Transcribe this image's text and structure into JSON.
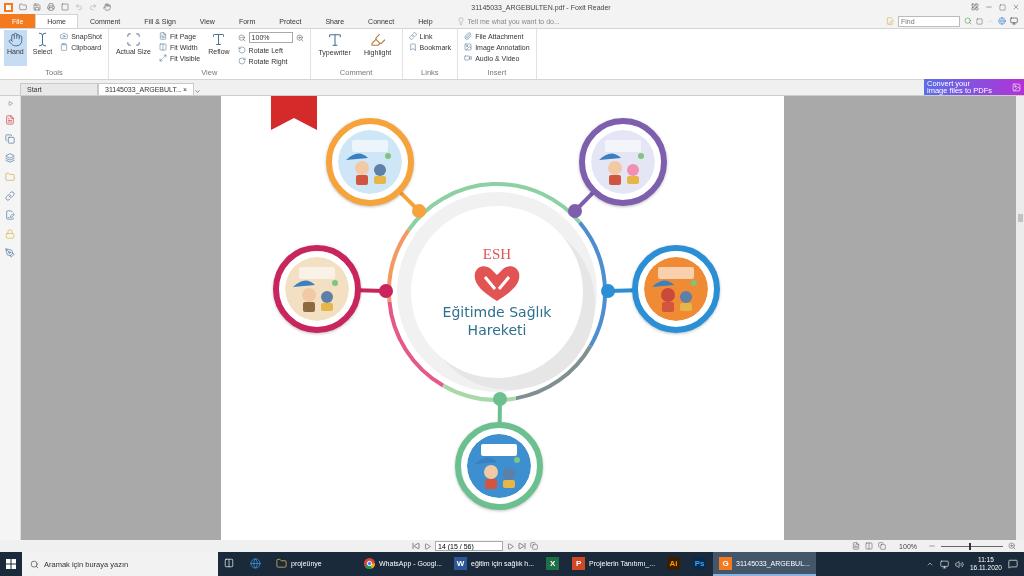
{
  "window": {
    "title": "31145033_ARGEBULTEN.pdf - Foxit Reader"
  },
  "menu_tabs": [
    {
      "label": "File",
      "kind": "file",
      "selected": false
    },
    {
      "label": "Home",
      "kind": "tab",
      "selected": true
    },
    {
      "label": "Comment",
      "kind": "tab",
      "selected": false
    },
    {
      "label": "Fill & Sign",
      "kind": "tab",
      "selected": false
    },
    {
      "label": "View",
      "kind": "tab",
      "selected": false
    },
    {
      "label": "Form",
      "kind": "tab",
      "selected": false
    },
    {
      "label": "Protect",
      "kind": "tab",
      "selected": false
    },
    {
      "label": "Share",
      "kind": "tab",
      "selected": false
    },
    {
      "label": "Connect",
      "kind": "tab",
      "selected": false
    },
    {
      "label": "Help",
      "kind": "tab",
      "selected": false
    }
  ],
  "tell_me": {
    "placeholder": "Tell me what you want to do..."
  },
  "find": {
    "placeholder": "Find"
  },
  "ribbon": {
    "groups": [
      {
        "title": "Tools",
        "items": [
          {
            "label": "Hand",
            "kind": "large",
            "selected": true
          },
          {
            "label": "Select",
            "kind": "large",
            "selected": false
          },
          {
            "label": "SnapShot",
            "kind": "small",
            "selected": false
          },
          {
            "label": "Clipboard",
            "kind": "small",
            "selected": false
          }
        ]
      },
      {
        "title": "View",
        "items": [
          {
            "label": "Actual Size",
            "kind": "large",
            "selected": false
          },
          {
            "label": "Fit Page",
            "kind": "small",
            "selected": false
          },
          {
            "label": "Fit Width",
            "kind": "small",
            "selected": false
          },
          {
            "label": "Fit Visible",
            "kind": "small",
            "selected": false
          },
          {
            "label": "Reflow",
            "kind": "large",
            "selected": false
          },
          {
            "label": "100%",
            "kind": "combo",
            "selected": false
          },
          {
            "label": "Rotate Left",
            "kind": "small",
            "selected": false
          },
          {
            "label": "Rotate Right",
            "kind": "small",
            "selected": false
          }
        ]
      },
      {
        "title": "Comment",
        "items": [
          {
            "label": "Typewriter",
            "kind": "large",
            "selected": false
          },
          {
            "label": "Highlight",
            "kind": "large",
            "selected": false
          }
        ]
      },
      {
        "title": "Links",
        "items": [
          {
            "label": "Link",
            "kind": "small",
            "selected": false
          },
          {
            "label": "Bookmark",
            "kind": "small",
            "selected": false
          }
        ]
      },
      {
        "title": "Insert",
        "items": [
          {
            "label": "File Attachment",
            "kind": "small",
            "selected": false
          },
          {
            "label": "Image Annotation",
            "kind": "small",
            "selected": false
          },
          {
            "label": "Audio & Video",
            "kind": "small",
            "selected": false
          }
        ]
      }
    ]
  },
  "doc_tabs": [
    {
      "label": "Start",
      "selected": false
    },
    {
      "label": "31145033_ARGEBULT...",
      "selected": true,
      "close": "×"
    }
  ],
  "promo": {
    "lines": [
      "Convert your",
      "image files to PDFs"
    ]
  },
  "page": {
    "logo": {
      "acronym": "ESH",
      "line_1": "Eğitimde Sağlık",
      "line_2": "Hareketi"
    }
  },
  "status_bar": {
    "page_field": "14 (15 / 56)",
    "zoom": "100%",
    "zoom_slider": {
      "level": 0.45
    }
  },
  "taskbar": {
    "search": {
      "placeholder": "Aramak için buraya yazın"
    },
    "apps": [
      {
        "kind": "taskview",
        "selected": false
      },
      {
        "kind": "browser",
        "selected": false
      },
      {
        "kind": "folder",
        "label": "projeünye",
        "selected": false
      },
      {
        "kind": "chrome",
        "label": "WhatsApp - Googl...",
        "selected": false
      },
      {
        "kind": "word",
        "glyph": "W",
        "label": "eğitim için sağlık h...",
        "selected": false
      },
      {
        "kind": "excel",
        "glyph": "X",
        "selected": false
      },
      {
        "kind": "powerpoint",
        "glyph": "P",
        "label": "Projelerin Tanıtımı_...",
        "selected": false
      },
      {
        "kind": "illustrator",
        "glyph": "Ai",
        "selected": false
      },
      {
        "kind": "photoshop",
        "glyph": "Ps",
        "selected": false
      },
      {
        "kind": "foxit",
        "glyph": "G",
        "label": "31145033_ARGEBUL...",
        "selected": true
      }
    ],
    "time": "11:15",
    "date": "16.11.2020"
  }
}
